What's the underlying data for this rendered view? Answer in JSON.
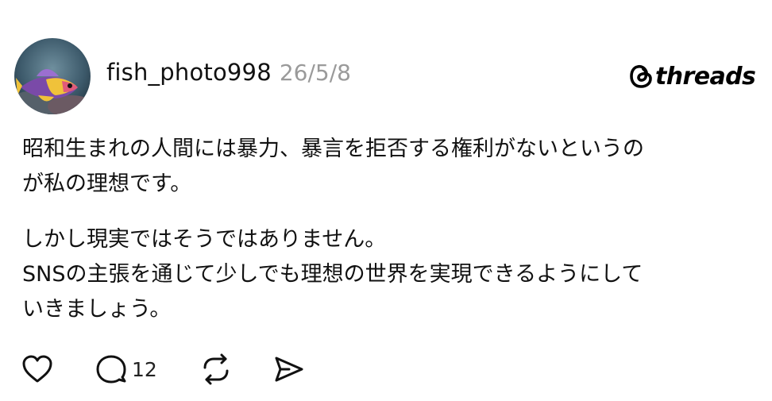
{
  "post": {
    "username": "fish_photo998",
    "date": "26/5/8",
    "brand": "threads",
    "paragraphs": [
      {
        "lines": [
          "昭和生まれの人間には暴力、暴言を拒否する権利がないというの",
          "が私の理想です。"
        ]
      },
      {
        "lines": [
          "しかし現実ではそうではありません。",
          "SNSの主張を通じて少しでも理想の世界を実現できるようにして",
          "いきましょう。"
        ]
      }
    ]
  },
  "actions": [
    {
      "icon": "heart-icon",
      "count": ""
    },
    {
      "icon": "comment-icon",
      "count": "12"
    },
    {
      "icon": "repost-icon",
      "count": ""
    },
    {
      "icon": "share-icon",
      "count": ""
    }
  ],
  "colors": {
    "text": "#111111",
    "muted": "#9a9a9a",
    "background": "#ffffff"
  }
}
